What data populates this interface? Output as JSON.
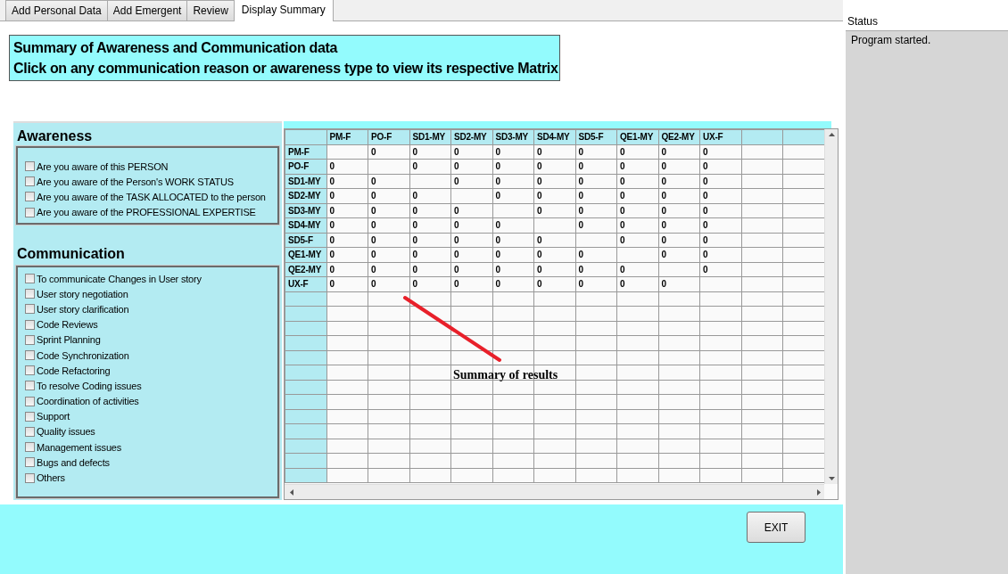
{
  "tabs": [
    {
      "label": "Add Personal Data",
      "selected": false
    },
    {
      "label": "Add Emergent",
      "selected": false
    },
    {
      "label": "Review",
      "selected": false
    },
    {
      "label": "Display Summary",
      "selected": true
    }
  ],
  "title_lines": [
    "Summary of Awareness and Communication data",
    "Click on any communication reason or awareness type to view its respective Matrix"
  ],
  "awareness": {
    "heading": "Awareness",
    "items": [
      {
        "label": "Are you aware of this PERSON",
        "checked": false
      },
      {
        "label": "Are you aware of the Person's WORK STATUS",
        "checked": false
      },
      {
        "label": "Are you aware of the TASK ALLOCATED to the person",
        "checked": false
      },
      {
        "label": "Are you aware of the PROFESSIONAL EXPERTISE",
        "checked": false
      }
    ]
  },
  "communication": {
    "heading": "Communication",
    "items": [
      {
        "label": "To communicate Changes in User story",
        "checked": false
      },
      {
        "label": "User story negotiation",
        "checked": false
      },
      {
        "label": "User story clarification",
        "checked": false
      },
      {
        "label": "Code Reviews",
        "checked": false
      },
      {
        "label": "Sprint Planning",
        "checked": false
      },
      {
        "label": "Code Synchronization",
        "checked": false
      },
      {
        "label": "Code Refactoring",
        "checked": false
      },
      {
        "label": "To resolve Coding issues",
        "checked": false
      },
      {
        "label": "Coordination of activities",
        "checked": false
      },
      {
        "label": "Support",
        "checked": false
      },
      {
        "label": "Quality issues",
        "checked": false
      },
      {
        "label": "Management issues",
        "checked": false
      },
      {
        "label": "Bugs and defects",
        "checked": false
      },
      {
        "label": "Others",
        "checked": false
      }
    ]
  },
  "matrix": {
    "columns": [
      "PM-F",
      "PO-F",
      "SD1-MY",
      "SD2-MY",
      "SD3-MY",
      "SD4-MY",
      "SD5-F",
      "QE1-MY",
      "QE2-MY",
      "UX-F"
    ],
    "rows": [
      {
        "header": "PM-F",
        "cells": [
          null,
          "0",
          "0",
          "0",
          "0",
          "0",
          "0",
          "0",
          "0",
          "0"
        ]
      },
      {
        "header": "PO-F",
        "cells": [
          "0",
          null,
          "0",
          "0",
          "0",
          "0",
          "0",
          "0",
          "0",
          "0"
        ]
      },
      {
        "header": "SD1-MY",
        "cells": [
          "0",
          "0",
          null,
          "0",
          "0",
          "0",
          "0",
          "0",
          "0",
          "0"
        ]
      },
      {
        "header": "SD2-MY",
        "cells": [
          "0",
          "0",
          "0",
          null,
          "0",
          "0",
          "0",
          "0",
          "0",
          "0"
        ]
      },
      {
        "header": "SD3-MY",
        "cells": [
          "0",
          "0",
          "0",
          "0",
          null,
          "0",
          "0",
          "0",
          "0",
          "0"
        ]
      },
      {
        "header": "SD4-MY",
        "cells": [
          "0",
          "0",
          "0",
          "0",
          "0",
          null,
          "0",
          "0",
          "0",
          "0"
        ]
      },
      {
        "header": "SD5-F",
        "cells": [
          "0",
          "0",
          "0",
          "0",
          "0",
          "0",
          null,
          "0",
          "0",
          "0"
        ]
      },
      {
        "header": "QE1-MY",
        "cells": [
          "0",
          "0",
          "0",
          "0",
          "0",
          "0",
          "0",
          null,
          "0",
          "0"
        ]
      },
      {
        "header": "QE2-MY",
        "cells": [
          "0",
          "0",
          "0",
          "0",
          "0",
          "0",
          "0",
          "0",
          null,
          "0"
        ]
      },
      {
        "header": "UX-F",
        "cells": [
          "0",
          "0",
          "0",
          "0",
          "0",
          "0",
          "0",
          "0",
          "0",
          null
        ]
      }
    ]
  },
  "annotation": {
    "text": "Summary of results"
  },
  "exit_button": "EXIT",
  "status": {
    "title": "Status",
    "message": "Program started."
  }
}
